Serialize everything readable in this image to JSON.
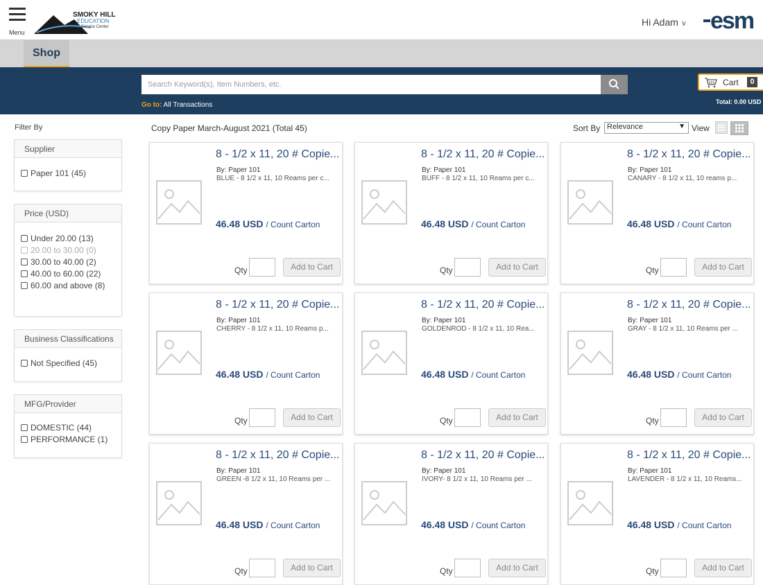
{
  "header": {
    "menu_label": "Menu",
    "logo_text": "SMOKY HILL EDUCATION Service Center",
    "greeting": "Hi Adam",
    "brand_logo_text": "esm"
  },
  "tabs": [
    {
      "label": "Shop",
      "active": true
    }
  ],
  "search": {
    "placeholder": "Search Keyword(s), Item Numbers, etc.",
    "goto_label": "Go to:",
    "goto_link": "All Transactions"
  },
  "cart": {
    "label": "Cart",
    "count": "0",
    "total": "Total: 0.00 USD"
  },
  "filters": {
    "title": "Filter By",
    "groups": [
      {
        "name": "Supplier",
        "items": [
          {
            "label": "Paper 101 (45)",
            "disabled": false
          }
        ]
      },
      {
        "name": "Price (USD)",
        "items": [
          {
            "label": "Under 20.00 (13)",
            "disabled": false
          },
          {
            "label": "20.00 to 30.00 (0)",
            "disabled": true
          },
          {
            "label": "30.00 to 40.00 (2)",
            "disabled": false
          },
          {
            "label": "40.00 to 60.00 (22)",
            "disabled": false
          },
          {
            "label": "60.00 and above (8)",
            "disabled": false
          }
        ]
      },
      {
        "name": "Business Classifications",
        "items": [
          {
            "label": "Not Specified (45)",
            "disabled": false
          }
        ]
      },
      {
        "name": "MFG/Provider",
        "items": [
          {
            "label": "DOMESTIC (44)",
            "disabled": false
          },
          {
            "label": "PERFORMANCE (1)",
            "disabled": false
          }
        ]
      }
    ]
  },
  "results": {
    "title": "Copy Paper March-August 2021 (Total 45)",
    "sort_label": "Sort By",
    "sort_value": "Relevance",
    "view_label": "View"
  },
  "product_common": {
    "name": "8 - 1/2 x 11, 20 # Copie...",
    "by": "By: Paper 101",
    "price": "46.48 USD",
    "unit": "/ Count Carton",
    "qty_label": "Qty",
    "add_label": "Add to Cart"
  },
  "products": [
    {
      "desc": "BLUE - 8 1/2 x 11, 10 Reams per c..."
    },
    {
      "desc": "BUFF - 8 1/2 x 11, 10 Reams per c..."
    },
    {
      "desc": "CANARY - 8 1/2 x 11, 10 reams p..."
    },
    {
      "desc": "CHERRY - 8 1/2 x 11, 10 Reams p..."
    },
    {
      "desc": "GOLDENROD - 8 1/2 x 11, 10 Rea..."
    },
    {
      "desc": "GRAY - 8 1/2 x 11, 10 Reams per ..."
    },
    {
      "desc": "GREEN -8 1/2 x 11, 10 Reams per ..."
    },
    {
      "desc": "IVORY- 8 1/2 x 11, 10 Reams per ..."
    },
    {
      "desc": "LAVENDER - 8 1/2 x 11, 10 Reams..."
    }
  ],
  "colors": {
    "band": "#1d3e5e",
    "accent": "#f0a020",
    "link": "#2a4a7a"
  }
}
